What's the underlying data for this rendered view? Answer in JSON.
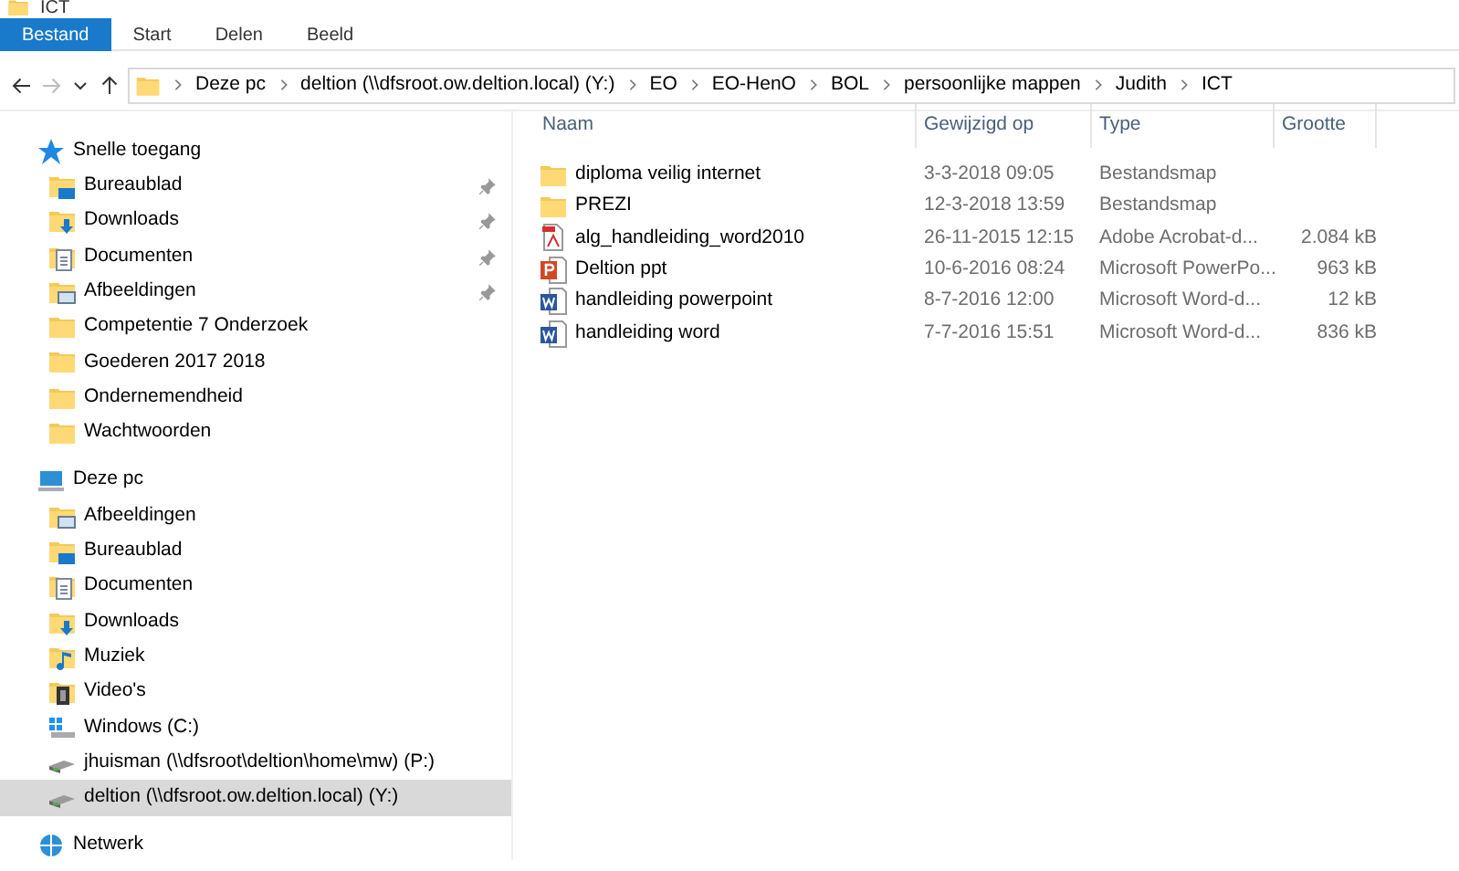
{
  "window": {
    "title": "ICT"
  },
  "ribbon_tabs": [
    {
      "label": "Bestand",
      "selected": true
    },
    {
      "label": "Start",
      "selected": false
    },
    {
      "label": "Delen",
      "selected": false
    },
    {
      "label": "Beeld",
      "selected": false
    }
  ],
  "breadcrumb": [
    "Deze pc",
    "deltion (\\\\dfsroot.ow.deltion.local) (Y:)",
    "EO",
    "EO-HenO",
    "BOL",
    "persoonlijke mappen",
    "Judith",
    "ICT"
  ],
  "sidebar": [
    {
      "label": "Snelle toegang",
      "kind": "star",
      "selected": false,
      "children": [
        {
          "label": "Bureaublad",
          "kind": "desktop",
          "pinned": true,
          "selected": false
        },
        {
          "label": "Downloads",
          "kind": "download",
          "pinned": true,
          "selected": false
        },
        {
          "label": "Documenten",
          "kind": "document",
          "pinned": true,
          "selected": false
        },
        {
          "label": "Afbeeldingen",
          "kind": "picture",
          "pinned": true,
          "selected": false
        },
        {
          "label": "Competentie 7 Onderzoek",
          "kind": "folder",
          "pinned": false,
          "selected": false
        },
        {
          "label": "Goederen 2017 2018",
          "kind": "folder",
          "pinned": false,
          "selected": false
        },
        {
          "label": "Ondernemendheid",
          "kind": "folder",
          "pinned": false,
          "selected": false
        },
        {
          "label": "Wachtwoorden",
          "kind": "folder",
          "pinned": false,
          "selected": false
        }
      ]
    },
    {
      "label": "Deze pc",
      "kind": "pc",
      "selected": false,
      "children": [
        {
          "label": "Afbeeldingen",
          "kind": "picture",
          "pinned": false,
          "selected": false
        },
        {
          "label": "Bureaublad",
          "kind": "desktop",
          "pinned": false,
          "selected": false
        },
        {
          "label": "Documenten",
          "kind": "document",
          "pinned": false,
          "selected": false
        },
        {
          "label": "Downloads",
          "kind": "download",
          "pinned": false,
          "selected": false
        },
        {
          "label": "Muziek",
          "kind": "music",
          "pinned": false,
          "selected": false
        },
        {
          "label": "Video's",
          "kind": "video",
          "pinned": false,
          "selected": false
        },
        {
          "label": "Windows (C:)",
          "kind": "drive",
          "pinned": false,
          "selected": false
        },
        {
          "label": "jhuisman (\\\\dfsroot\\deltion\\home\\mw) (P:)",
          "kind": "netdrive",
          "pinned": false,
          "selected": false
        },
        {
          "label": "deltion (\\\\dfsroot.ow.deltion.local) (Y:)",
          "kind": "netdrive",
          "pinned": false,
          "selected": true
        }
      ]
    },
    {
      "label": "Netwerk",
      "kind": "network",
      "selected": false
    }
  ],
  "table": {
    "columns": [
      "Naam",
      "Gewijzigd op",
      "Type",
      "Grootte"
    ],
    "rows": [
      {
        "name": "diploma veilig internet",
        "modified": "3-3-2018 09:05",
        "type": "Bestandsmap",
        "size": "",
        "kind": "folder"
      },
      {
        "name": "PREZI",
        "modified": "12-3-2018 13:59",
        "type": "Bestandsmap",
        "size": "",
        "kind": "folder"
      },
      {
        "name": "alg_handleiding_word2010",
        "modified": "26-11-2015 12:15",
        "type": "Adobe Acrobat-d...",
        "size": "2.084 kB",
        "kind": "pdf"
      },
      {
        "name": "Deltion ppt",
        "modified": "10-6-2016 08:24",
        "type": "Microsoft PowerPo...",
        "size": "963 kB",
        "kind": "ppt"
      },
      {
        "name": "handleiding powerpoint",
        "modified": "8-7-2016 12:00",
        "type": "Microsoft Word-d...",
        "size": "12 kB",
        "kind": "word"
      },
      {
        "name": "handleiding word",
        "modified": "7-7-2016 15:51",
        "type": "Microsoft Word-d...",
        "size": "836 kB",
        "kind": "word"
      }
    ]
  }
}
